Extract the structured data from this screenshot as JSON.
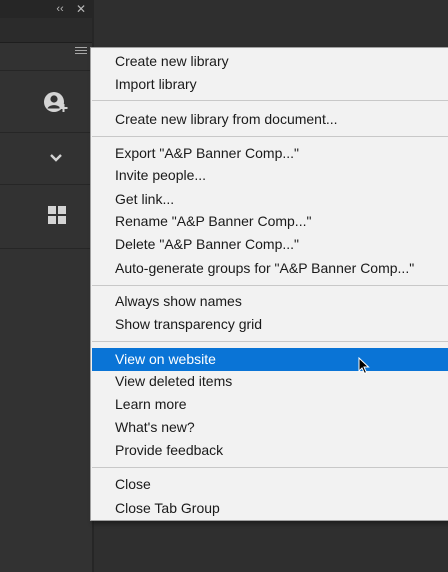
{
  "panel": {
    "collapse_glyph": "‹‹",
    "close_glyph": "✕",
    "icons": [
      "add-user-icon",
      "chevron-down-icon",
      "grid-view-icon",
      "panel-menu-icon"
    ]
  },
  "menu": {
    "highlight_color": "#0a74d6",
    "groups": [
      [
        "Create new library",
        "Import library"
      ],
      [
        "Create new library from document..."
      ],
      [
        "Export \"A&P Banner Comp...\"",
        "Invite people...",
        "Get link...",
        "Rename \"A&P Banner Comp...\"",
        "Delete \"A&P Banner Comp...\"",
        "Auto-generate groups for \"A&P Banner Comp...\""
      ],
      [
        "Always show names",
        "Show transparency grid"
      ],
      [
        "View on website",
        "View deleted items",
        "Learn more",
        "What's new?",
        "Provide feedback"
      ],
      [
        "Close",
        "Close Tab Group"
      ]
    ],
    "highlighted_item": "View on website"
  }
}
